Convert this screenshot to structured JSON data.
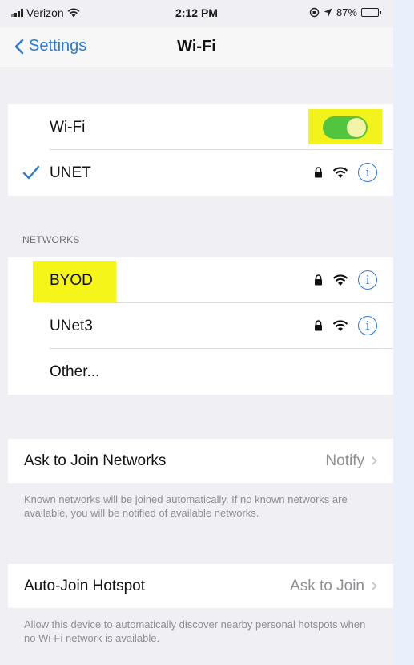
{
  "status_bar": {
    "carrier": "Verizon",
    "time": "2:12 PM",
    "battery": "87%"
  },
  "nav": {
    "back_label": "Settings",
    "title": "Wi-Fi"
  },
  "wifi_group": {
    "wifi_label": "Wi-Fi",
    "connected_network": "UNET"
  },
  "networks_section": {
    "header": "NETWORKS",
    "items": [
      {
        "name": "BYOD"
      },
      {
        "name": "UNet3"
      },
      {
        "name": "Other..."
      }
    ]
  },
  "ask_to_join": {
    "label": "Ask to Join Networks",
    "value": "Notify",
    "footnote": "Known networks will be joined automatically. If no known networks are available, you will be notified of available networks."
  },
  "auto_join": {
    "label": "Auto-Join Hotspot",
    "value": "Ask to Join",
    "footnote": "Allow this device to automatically discover nearby personal hotspots when no Wi-Fi network is available."
  },
  "colors": {
    "accent": "#2b7ad6",
    "toggle_on": "#53c53d",
    "highlight": "#f2f21c"
  },
  "icons": [
    "signal-icon",
    "wifi-status-icon",
    "location-icon",
    "battery-icon",
    "chevron-left-icon",
    "checkmark-icon",
    "lock-icon",
    "wifi-icon",
    "info-icon",
    "chevron-right-icon"
  ]
}
